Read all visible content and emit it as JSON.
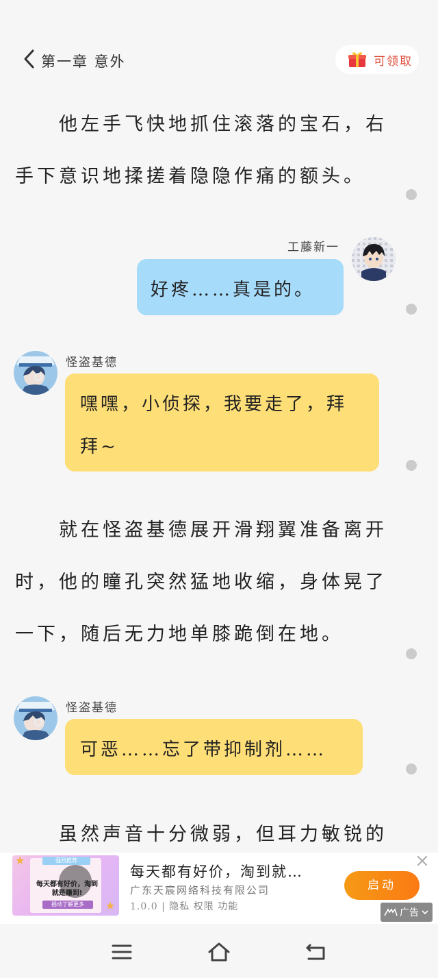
{
  "header": {
    "chapter_title": "第一章 意外",
    "reward_label": "可领取"
  },
  "content": {
    "para1_line1": "他左手飞快地抓住滚落的宝石，右",
    "para1_line2": "手下意识地揉搓着隐隐作痛的额头。",
    "msg1": {
      "speaker": "工藤新一",
      "text": "好疼……真是的。"
    },
    "msg2": {
      "speaker": "怪盗基德",
      "line1": "嘿嘿，小侦探，我要走了，拜",
      "line2": "拜~"
    },
    "para2_line1": "就在怪盗基德展开滑翔翼准备离开",
    "para2_line2": "时，他的瞳孔突然猛地收缩，身体晃了",
    "para2_line3": "一下，随后无力地单膝跪倒在地。",
    "msg3": {
      "speaker": "怪盗基德",
      "text": "可恶……忘了带抑制剂……"
    },
    "para3_line1": "虽然声音十分微弱，但耳力敏锐的"
  },
  "ad": {
    "title": "每天都有好价，淘到就…",
    "company": "广东天宸网络科技有限公司",
    "meta": "1.0.0 | 隐私  权限  功能",
    "launch_label": "启动",
    "badge_label": "广告",
    "image_tag": "强烈推荐",
    "image_text": "每天都有好价，淘到就是赚到!",
    "image_bar": "摇动了解更多"
  },
  "colors": {
    "background": "#f6f6f6",
    "bubble_blue": "#a7dbfa",
    "bubble_yellow": "#fede77",
    "reward_red": "#e0503c",
    "launch_orange": "#f59a16"
  },
  "icons": [
    "chevron-left-icon",
    "gift-icon",
    "close-icon",
    "menu-icon",
    "home-icon",
    "back-icon"
  ]
}
